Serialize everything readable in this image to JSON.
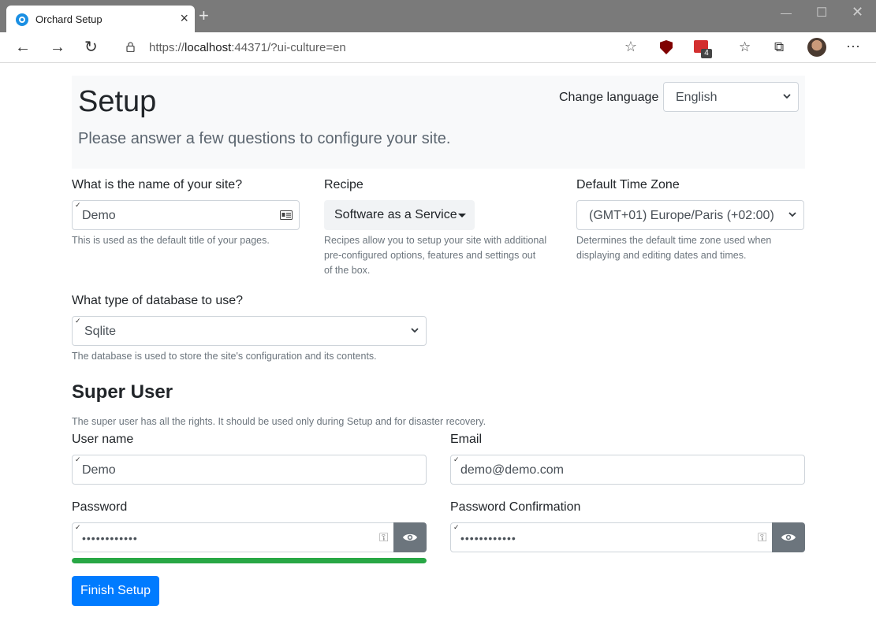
{
  "browser": {
    "tab_title": "Orchard Setup",
    "url_prefix": "https://",
    "url_host": "localhost",
    "url_rest": ":44371/?ui-culture=en",
    "extension_badge": "4"
  },
  "page": {
    "title": "Setup",
    "lead": "Please answer a few questions to configure your site.",
    "change_language_label": "Change language",
    "language_value": "English"
  },
  "site": {
    "name_label": "What is the name of your site?",
    "name_value": "Demo",
    "name_help": "This is used as the default title of your pages.",
    "recipe_label": "Recipe",
    "recipe_value": "Software as a Service",
    "recipe_help_1": "Recipes allow you to setup your site with additional",
    "recipe_help_2": "pre-configured options, features and settings out",
    "recipe_help_3": "of the box.",
    "timezone_label": "Default Time Zone",
    "timezone_value": "(GMT+01) Europe/Paris (+02:00)",
    "timezone_help_1": "Determines the default time zone used when",
    "timezone_help_2": "displaying and editing dates and times."
  },
  "database": {
    "label": "What type of database to use?",
    "value": "Sqlite",
    "help": "The database is used to store the site's configuration and its contents."
  },
  "super_user": {
    "title": "Super User",
    "help": "The super user has all the rights. It should be used only during Setup and for disaster recovery.",
    "username_label": "User name",
    "username_value": "Demo",
    "email_label": "Email",
    "email_value": "demo@demo.com",
    "password_label": "Password",
    "password_value": "••••••••••••",
    "password_confirm_label": "Password Confirmation",
    "password_confirm_value": "••••••••••••",
    "password_strength_percent": 100
  },
  "actions": {
    "finish_label": "Finish Setup"
  },
  "colors": {
    "primary": "#007bff",
    "success": "#28a745",
    "secondary": "#6c757d"
  }
}
